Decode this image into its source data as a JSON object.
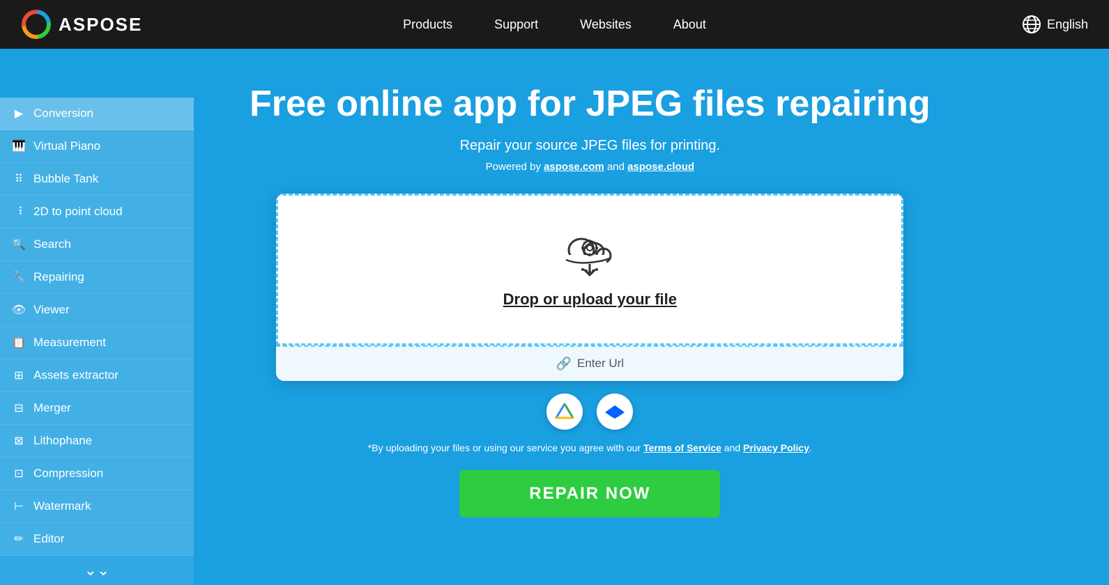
{
  "header": {
    "logo_text": "ASPOSE",
    "nav": [
      {
        "label": "Products",
        "id": "products"
      },
      {
        "label": "Support",
        "id": "support"
      },
      {
        "label": "Websites",
        "id": "websites"
      },
      {
        "label": "About",
        "id": "about"
      }
    ],
    "lang_label": "English"
  },
  "sidebar": {
    "items": [
      {
        "label": "Conversion",
        "icon": "▶",
        "id": "conversion"
      },
      {
        "label": "Virtual Piano",
        "icon": "🎹",
        "id": "virtual-piano"
      },
      {
        "label": "Bubble Tank",
        "icon": "⠿",
        "id": "bubble-tank"
      },
      {
        "label": "2D to point cloud",
        "icon": "⠸",
        "id": "2d-point-cloud"
      },
      {
        "label": "Search",
        "icon": "🔍",
        "id": "search"
      },
      {
        "label": "Repairing",
        "icon": "🔧",
        "id": "repairing"
      },
      {
        "label": "Viewer",
        "icon": "👁",
        "id": "viewer"
      },
      {
        "label": "Measurement",
        "icon": "📋",
        "id": "measurement"
      },
      {
        "label": "Assets extractor",
        "icon": "⊞",
        "id": "assets-extractor"
      },
      {
        "label": "Merger",
        "icon": "⊟",
        "id": "merger"
      },
      {
        "label": "Lithophane",
        "icon": "⊠",
        "id": "lithophane"
      },
      {
        "label": "Compression",
        "icon": "⊡",
        "id": "compression"
      },
      {
        "label": "Watermark",
        "icon": "⊢",
        "id": "watermark"
      },
      {
        "label": "Editor",
        "icon": "✏",
        "id": "editor"
      }
    ],
    "more_icon": "⌄⌄"
  },
  "main": {
    "title": "Free online app for JPEG files repairing",
    "subtitle": "Repair your source JPEG files for printing.",
    "powered_by_text": "Powered by ",
    "powered_by_link1": "aspose.com",
    "powered_by_and": " and ",
    "powered_by_link2": "aspose.cloud",
    "upload_drop_label": "Drop or upload your file",
    "upload_url_label": "Enter Url",
    "terms_prefix": "*By uploading your files or using our service you agree with our ",
    "terms_link1": "Terms of Service",
    "terms_and": " and ",
    "terms_link2": "Privacy Policy",
    "terms_suffix": ".",
    "repair_button_label": "REPAIR NOW"
  }
}
